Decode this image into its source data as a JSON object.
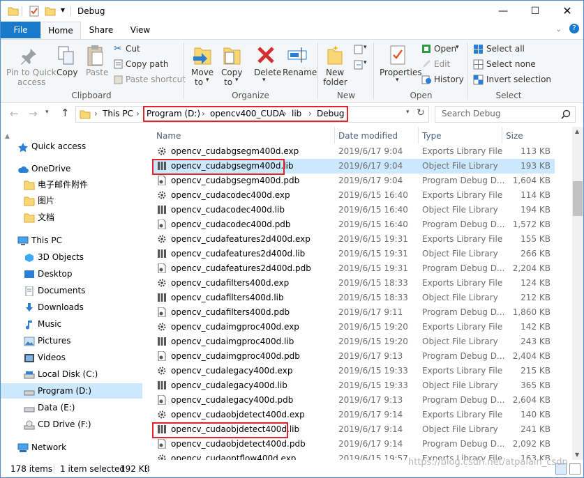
{
  "window": {
    "title": "Debug"
  },
  "tabs": {
    "file": "File",
    "home": "Home",
    "share": "Share",
    "view": "View"
  },
  "ribbon": {
    "clipboard": {
      "title": "Clipboard",
      "pin_line1": "Pin to Quick",
      "pin_line2": "access",
      "copy": "Copy",
      "paste": "Paste",
      "cut": "Cut",
      "copy_path": "Copy path",
      "paste_shortcut": "Paste shortcut"
    },
    "organize": {
      "title": "Organize",
      "move_line1": "Move",
      "move_line2": "to",
      "copy_line1": "Copy",
      "copy_line2": "to",
      "delete": "Delete",
      "rename": "Rename"
    },
    "new": {
      "title": "New",
      "line1": "New",
      "line2": "folder"
    },
    "open": {
      "title": "Open",
      "properties": "Properties",
      "open": "Open",
      "edit": "Edit",
      "history": "History"
    },
    "select": {
      "title": "Select",
      "select_all": "Select all",
      "select_none": "Select none",
      "invert": "Invert selection"
    }
  },
  "address": {
    "crumbs": [
      "This PC",
      "Program (D:)",
      "opencv400_CUDA",
      "lib",
      "Debug"
    ],
    "search_placeholder": "Search Debug"
  },
  "nav": {
    "quick_access": "Quick access",
    "onedrive": "OneDrive",
    "od_items": [
      "电子邮件附件",
      "图片",
      "文档"
    ],
    "this_pc": "This PC",
    "pc_items": [
      "3D Objects",
      "Desktop",
      "Documents",
      "Downloads",
      "Music",
      "Pictures",
      "Videos",
      "Local Disk (C:)",
      "Program (D:)",
      "Data (E:)",
      "CD Drive (F:)"
    ],
    "network": "Network"
  },
  "columns": {
    "name": "Name",
    "date": "Date modified",
    "type": "Type",
    "size": "Size"
  },
  "files": [
    {
      "name": "opencv_cudabgsegm400d.exp",
      "date": "2019/6/17 9:04",
      "type": "Exports Library File",
      "size": "113 KB",
      "kind": "exp"
    },
    {
      "name": "opencv_cudabgsegm400d.lib",
      "date": "2019/6/17 9:04",
      "type": "Object File Library",
      "size": "193 KB",
      "kind": "lib",
      "selected": true
    },
    {
      "name": "opencv_cudabgsegm400d.pdb",
      "date": "2019/6/17 9:04",
      "type": "Program Debug D...",
      "size": "1,604 KB",
      "kind": "pdb"
    },
    {
      "name": "opencv_cudacodec400d.exp",
      "date": "2019/6/15 16:40",
      "type": "Exports Library File",
      "size": "114 KB",
      "kind": "exp"
    },
    {
      "name": "opencv_cudacodec400d.lib",
      "date": "2019/6/15 16:40",
      "type": "Object File Library",
      "size": "194 KB",
      "kind": "lib"
    },
    {
      "name": "opencv_cudacodec400d.pdb",
      "date": "2019/6/15 16:40",
      "type": "Program Debug D...",
      "size": "1,572 KB",
      "kind": "pdb"
    },
    {
      "name": "opencv_cudafeatures2d400d.exp",
      "date": "2019/6/15 19:31",
      "type": "Exports Library File",
      "size": "155 KB",
      "kind": "exp"
    },
    {
      "name": "opencv_cudafeatures2d400d.lib",
      "date": "2019/6/15 19:31",
      "type": "Object File Library",
      "size": "266 KB",
      "kind": "lib"
    },
    {
      "name": "opencv_cudafeatures2d400d.pdb",
      "date": "2019/6/15 19:31",
      "type": "Program Debug D...",
      "size": "2,204 KB",
      "kind": "pdb"
    },
    {
      "name": "opencv_cudafilters400d.exp",
      "date": "2019/6/15 18:33",
      "type": "Exports Library File",
      "size": "124 KB",
      "kind": "exp"
    },
    {
      "name": "opencv_cudafilters400d.lib",
      "date": "2019/6/15 18:33",
      "type": "Object File Library",
      "size": "212 KB",
      "kind": "lib"
    },
    {
      "name": "opencv_cudafilters400d.pdb",
      "date": "2019/6/17 9:11",
      "type": "Program Debug D...",
      "size": "1,860 KB",
      "kind": "pdb"
    },
    {
      "name": "opencv_cudaimgproc400d.exp",
      "date": "2019/6/15 19:20",
      "type": "Exports Library File",
      "size": "142 KB",
      "kind": "exp"
    },
    {
      "name": "opencv_cudaimgproc400d.lib",
      "date": "2019/6/15 19:20",
      "type": "Object File Library",
      "size": "243 KB",
      "kind": "lib"
    },
    {
      "name": "opencv_cudaimgproc400d.pdb",
      "date": "2019/6/17 9:13",
      "type": "Program Debug D...",
      "size": "2,404 KB",
      "kind": "pdb"
    },
    {
      "name": "opencv_cudalegacy400d.exp",
      "date": "2019/6/15 19:33",
      "type": "Exports Library File",
      "size": "215 KB",
      "kind": "exp"
    },
    {
      "name": "opencv_cudalegacy400d.lib",
      "date": "2019/6/15 19:33",
      "type": "Object File Library",
      "size": "365 KB",
      "kind": "lib"
    },
    {
      "name": "opencv_cudalegacy400d.pdb",
      "date": "2019/6/17 9:13",
      "type": "Program Debug D...",
      "size": "2,604 KB",
      "kind": "pdb"
    },
    {
      "name": "opencv_cudaobjdetect400d.exp",
      "date": "2019/6/17 9:14",
      "type": "Exports Library File",
      "size": "140 KB",
      "kind": "exp"
    },
    {
      "name": "opencv_cudaobjdetect400d.lib",
      "date": "2019/6/17 9:14",
      "type": "Object File Library",
      "size": "241 KB",
      "kind": "lib"
    },
    {
      "name": "opencv_cudaobjdetect400d.pdb",
      "date": "2019/6/17 9:14",
      "type": "Program Debug D...",
      "size": "2,092 KB",
      "kind": "pdb"
    },
    {
      "name": "opencv_cudaoptflow400d.exp",
      "date": "2019/6/15 19:57",
      "type": "Exports Library File",
      "size": "163 KB",
      "kind": "exp"
    }
  ],
  "status": {
    "items": "178 items",
    "selected": "1 item selected",
    "size": "192 KB"
  },
  "watermark": "https://blog.csdn.net/atpalain_csdn",
  "colors": {
    "accent": "#1979ca",
    "selection": "#cce8ff",
    "highlight": "#e0242b"
  }
}
